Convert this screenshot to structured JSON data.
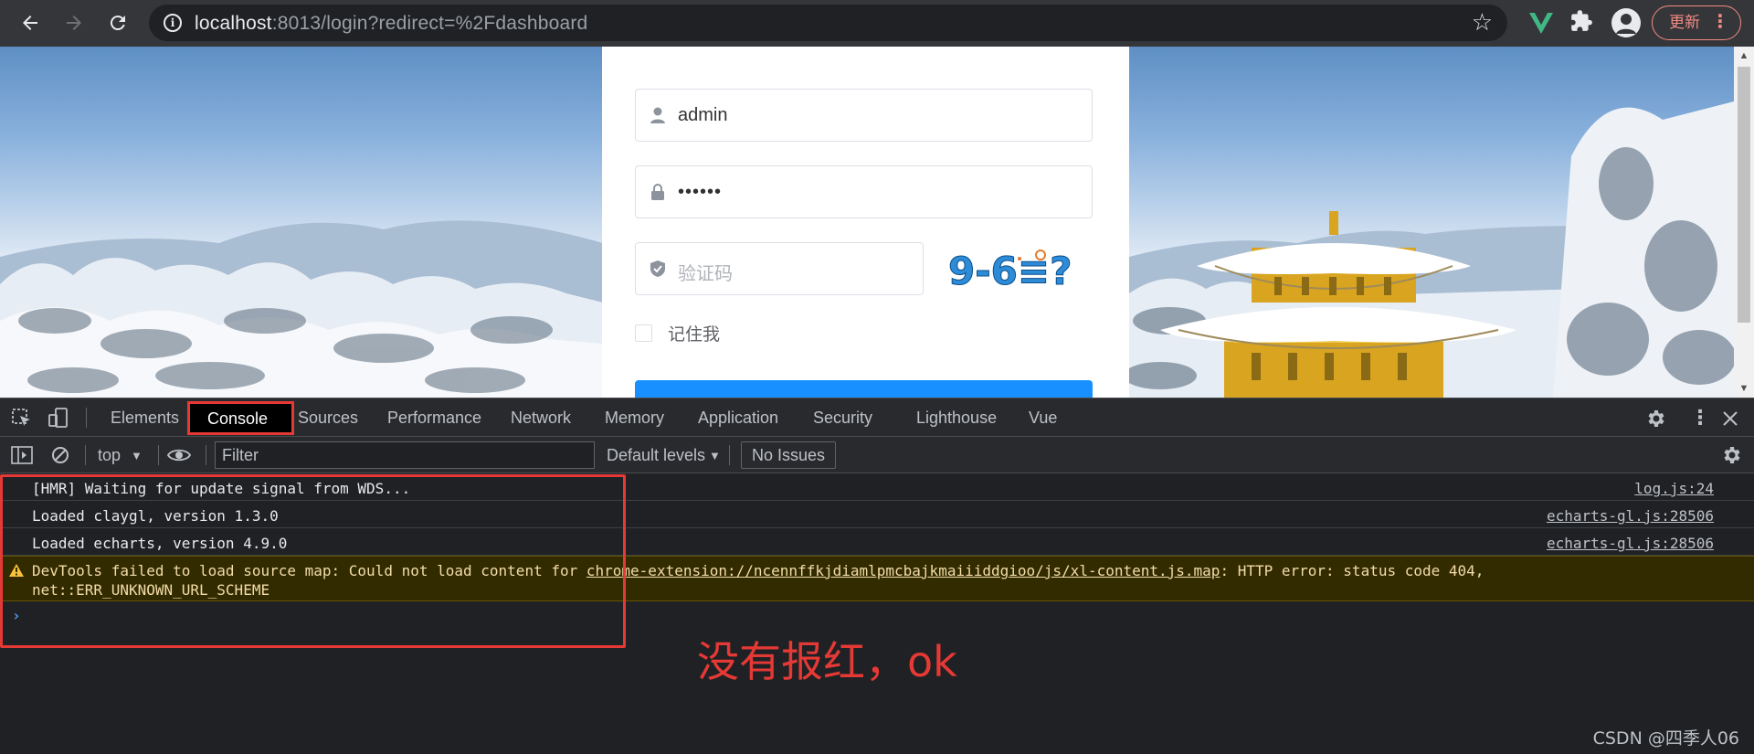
{
  "browser": {
    "url_host": "localhost",
    "url_rest": ":8013/login?redirect=%2Fdashboard",
    "update_label": "更新",
    "update_dots": "⋮",
    "icons": [
      "back-arrow-icon",
      "forward-arrow-icon",
      "reload-icon",
      "info-icon",
      "star-icon",
      "vue-devtools-icon",
      "puzzle-icon",
      "profile-icon",
      "kebab-menu-icon"
    ]
  },
  "login": {
    "username_value": "admin",
    "password_value": "••••••",
    "captcha_placeholder": "验证码",
    "captcha_text": "9-6≡?",
    "remember_label": "记住我",
    "button_color": "#1890ff"
  },
  "devtools": {
    "tabs": [
      "Elements",
      "Console",
      "Sources",
      "Performance",
      "Network",
      "Memory",
      "Application",
      "Security",
      "Lighthouse",
      "Vue"
    ],
    "active_tab": "Console",
    "context": "top",
    "filter_placeholder": "Filter",
    "levels": "Default levels",
    "issues": "No Issues",
    "messages": [
      {
        "text": "[HMR] Waiting for update signal from WDS...",
        "source": "log.js:24"
      },
      {
        "text": "Loaded claygl, version 1.3.0",
        "source": "echarts-gl.js:28506"
      },
      {
        "text": "Loaded echarts, version 4.9.0",
        "source": "echarts-gl.js:28506"
      }
    ],
    "warning": {
      "prefix": "DevTools failed to load source map: Could not load content for ",
      "link": "chrome-extension://ncennffkjdiamlpmcbajkmaiiiddgioo/js/xl-content.js.map",
      "suffix": ": HTTP error: status code 404,",
      "line2": "net::ERR_UNKNOWN_URL_SCHEME"
    },
    "prompt": "›"
  },
  "annotation": {
    "note": "没有报红，ok",
    "watermark": "CSDN @四季人06",
    "highlight_color": "#e53935"
  }
}
